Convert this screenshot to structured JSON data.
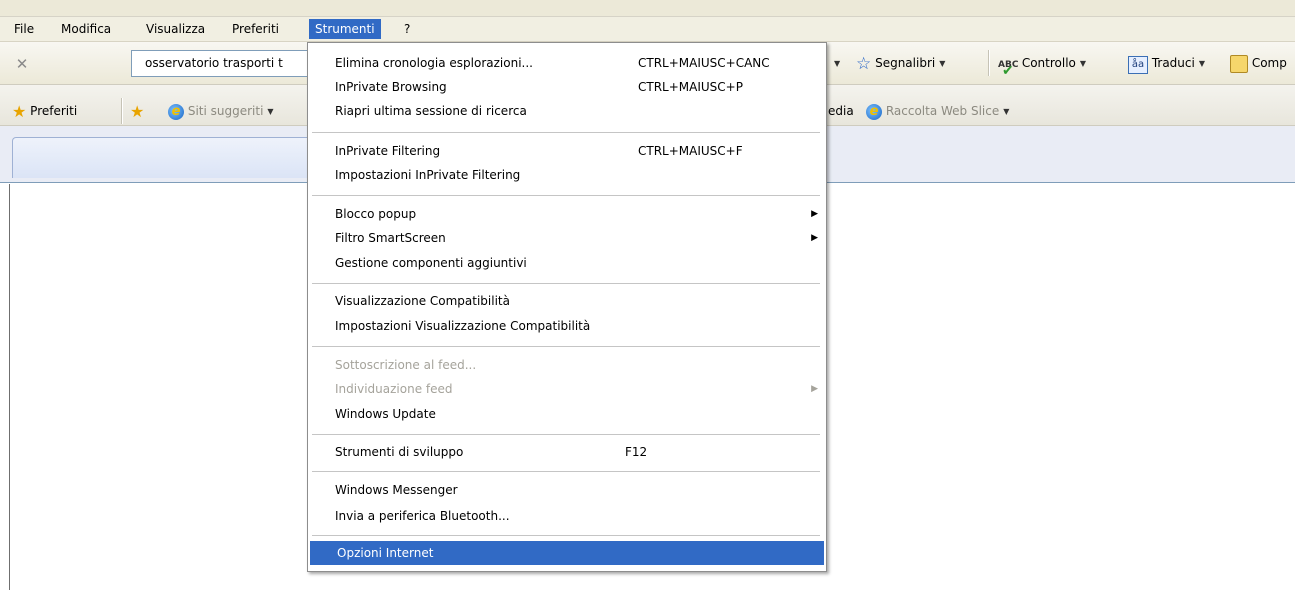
{
  "menubar": {
    "items": [
      "File",
      "Modifica",
      "Visualizza",
      "Preferiti",
      "Strumenti",
      "?"
    ],
    "active": "Strumenti"
  },
  "address_toolbar": {
    "stop_icon": "close-icon",
    "search_value": "osservatorio trasporti t",
    "bookmarks_label": "Segnalibri",
    "spellcheck_label": "Controllo",
    "translate_label": "Traduci",
    "compile_label": "Comp"
  },
  "favorites_bar": {
    "favorites_label": "Preferiti",
    "suggested_sites_label": "Siti suggeriti",
    "partial_label": "edia",
    "web_slice_label": "Raccolta Web Slice"
  },
  "tools_menu": {
    "groups": [
      [
        {
          "label": "Elimina cronologia esplorazioni...",
          "shortcut": "CTRL+MAIUSC+CANC"
        },
        {
          "label": "InPrivate Browsing",
          "shortcut": "CTRL+MAIUSC+P"
        },
        {
          "label": "Riapri ultima sessione di ricerca",
          "shortcut": ""
        }
      ],
      [
        {
          "label": "InPrivate Filtering",
          "shortcut": "CTRL+MAIUSC+F"
        },
        {
          "label": "Impostazioni InPrivate Filtering",
          "shortcut": ""
        }
      ],
      [
        {
          "label": "Blocco popup",
          "submenu": true
        },
        {
          "label": "Filtro SmartScreen",
          "submenu": true
        },
        {
          "label": "Gestione componenti aggiuntivi"
        }
      ],
      [
        {
          "label": "Visualizzazione Compatibilità"
        },
        {
          "label": "Impostazioni Visualizzazione Compatibilità"
        }
      ],
      [
        {
          "label": "Sottoscrizione al feed...",
          "disabled": true
        },
        {
          "label": "Individuazione feed",
          "disabled": true,
          "submenu": true
        },
        {
          "label": "Windows Update"
        }
      ],
      [
        {
          "label": "Strumenti di sviluppo",
          "shortcut": "F12"
        }
      ],
      [
        {
          "label": "Windows Messenger"
        },
        {
          "label": "Invia a periferica Bluetooth..."
        }
      ],
      [
        {
          "label": "Opzioni Internet",
          "selected": true
        }
      ]
    ]
  },
  "colors": {
    "menu_highlight": "#316ac5",
    "disabled_text": "#a5a39b",
    "toolbar_bg": "#ece9d8"
  }
}
